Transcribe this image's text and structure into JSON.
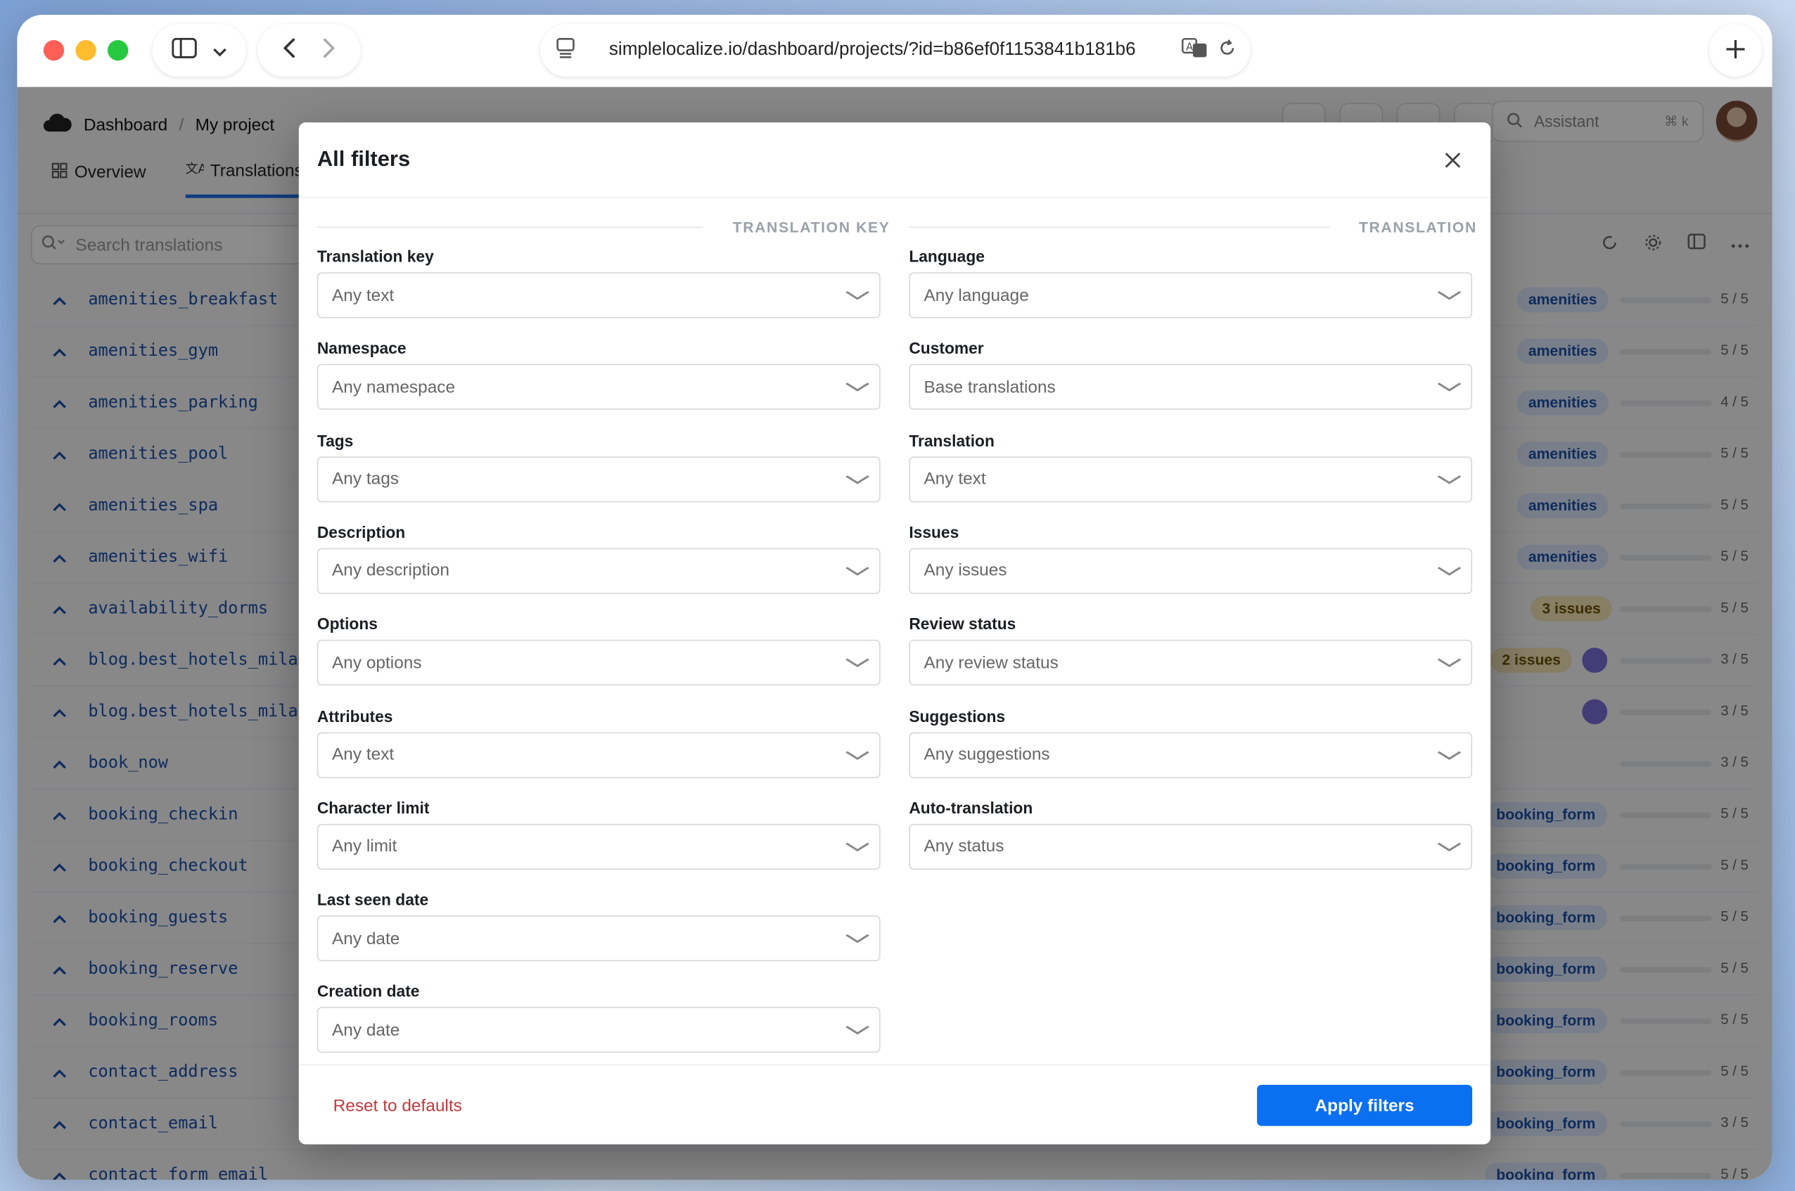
{
  "browser": {
    "url": "simplelocalize.io/dashboard/projects/?id=b86ef0f1153841b181b6"
  },
  "app": {
    "breadcrumb": {
      "root": "Dashboard",
      "separator": "/",
      "project": "My project"
    },
    "assistant": {
      "label": "Assistant",
      "shortcut": "⌘ k"
    },
    "tabs": [
      {
        "label": "Overview"
      },
      {
        "label": "Translations"
      }
    ],
    "search_placeholder": "Search translations",
    "rows": [
      {
        "key": "amenities_breakfast",
        "tag": "amenities",
        "count": "5 / 5"
      },
      {
        "key": "amenities_gym",
        "tag": "amenities",
        "count": "5 / 5"
      },
      {
        "key": "amenities_parking",
        "tag": "amenities",
        "count": "4 / 5"
      },
      {
        "key": "amenities_pool",
        "tag": "amenities",
        "count": "5 / 5"
      },
      {
        "key": "amenities_spa",
        "tag": "amenities",
        "count": "5 / 5"
      },
      {
        "key": "amenities_wifi",
        "tag": "amenities",
        "count": "5 / 5"
      },
      {
        "key": "availability_dorms",
        "tag": "3 issues",
        "count": "5 / 5"
      },
      {
        "key": "blog.best_hotels_milan",
        "tag": "2 issues",
        "count": "3 / 5"
      },
      {
        "key": "blog.best_hotels_milan",
        "tag": "",
        "count": "3 / 5"
      },
      {
        "key": "book_now",
        "tag": "",
        "count": "3 / 5"
      },
      {
        "key": "booking_checkin",
        "tag": "booking_form",
        "count": "5 / 5"
      },
      {
        "key": "booking_checkout",
        "tag": "booking_form",
        "count": "5 / 5"
      },
      {
        "key": "booking_guests",
        "tag": "booking_form",
        "count": "5 / 5"
      },
      {
        "key": "booking_reserve",
        "tag": "booking_form",
        "count": "5 / 5"
      },
      {
        "key": "booking_rooms",
        "tag": "booking_form",
        "count": "5 / 5"
      },
      {
        "key": "contact_address",
        "tag": "booking_form",
        "count": "5 / 5"
      },
      {
        "key": "contact_email",
        "tag": "booking_form",
        "count": "3 / 5"
      },
      {
        "key": "contact_form_email",
        "tag": "booking_form",
        "count": "5 / 5"
      }
    ]
  },
  "modal": {
    "title": "All filters",
    "left_section": "TRANSLATION KEY",
    "right_section": "TRANSLATION",
    "left_fields": [
      {
        "label": "Translation key",
        "value": "Any text"
      },
      {
        "label": "Namespace",
        "value": "Any namespace"
      },
      {
        "label": "Tags",
        "value": "Any tags"
      },
      {
        "label": "Description",
        "value": "Any description"
      },
      {
        "label": "Options",
        "value": "Any options"
      },
      {
        "label": "Attributes",
        "value": "Any text"
      },
      {
        "label": "Character limit",
        "value": "Any limit"
      },
      {
        "label": "Last seen date",
        "value": "Any date"
      },
      {
        "label": "Creation date",
        "value": "Any date"
      }
    ],
    "right_fields": [
      {
        "label": "Language",
        "value": "Any language"
      },
      {
        "label": "Customer",
        "value": "Base translations"
      },
      {
        "label": "Translation",
        "value": "Any text"
      },
      {
        "label": "Issues",
        "value": "Any issues"
      },
      {
        "label": "Review status",
        "value": "Any review status"
      },
      {
        "label": "Suggestions",
        "value": "Any suggestions"
      },
      {
        "label": "Auto-translation",
        "value": "Any status"
      }
    ],
    "reset_label": "Reset to defaults",
    "apply_label": "Apply filters"
  }
}
